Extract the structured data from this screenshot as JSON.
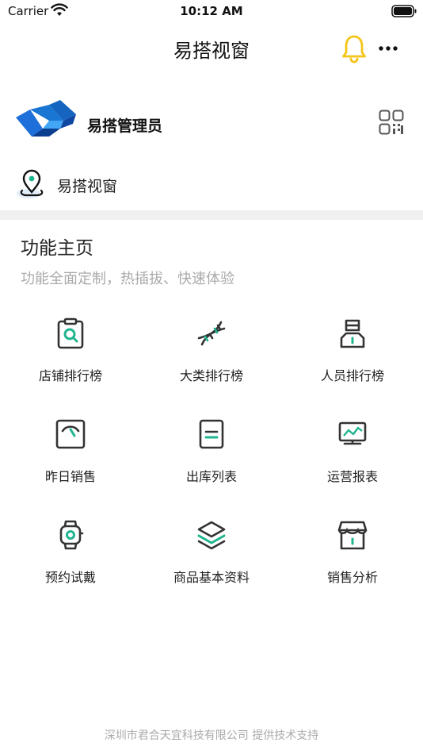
{
  "status_bar": {
    "carrier": "Carrier",
    "time": "10:12 AM"
  },
  "nav": {
    "title": "易搭视窗",
    "icons": [
      "bell-icon",
      "more-icon"
    ],
    "bell_color": "#F5C518"
  },
  "profile": {
    "name": "易搭管理员",
    "logo_color": "#1565C0"
  },
  "store": {
    "name": "易搭视窗"
  },
  "section": {
    "title": "功能主页",
    "subtitle": "功能全面定制，热插拔、快速体验"
  },
  "features": [
    {
      "label": "店铺排行榜",
      "icon": "store-search-icon"
    },
    {
      "label": "大类排行榜",
      "icon": "dna-icon"
    },
    {
      "label": "人员排行榜",
      "icon": "person-icon"
    },
    {
      "label": "昨日销售",
      "icon": "gauge-icon"
    },
    {
      "label": "出库列表",
      "icon": "document-icon"
    },
    {
      "label": "运营报表",
      "icon": "monitor-chart-icon"
    },
    {
      "label": "预约试戴",
      "icon": "watch-icon"
    },
    {
      "label": "商品基本资料",
      "icon": "layers-icon"
    },
    {
      "label": "销售分析",
      "icon": "shop-icon"
    }
  ],
  "accent_color": "#1FB58F",
  "footer": "深圳市君合天宜科技有限公司 提供技术支持"
}
